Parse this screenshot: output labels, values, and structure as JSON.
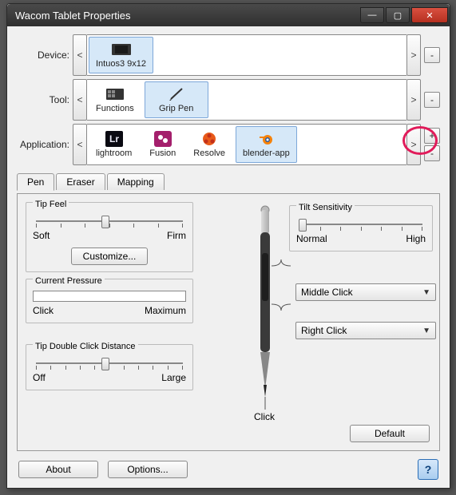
{
  "window": {
    "title": "Wacom Tablet Properties"
  },
  "selectors": {
    "device": {
      "label": "Device:",
      "items": [
        {
          "label": "Intuos3 9x12",
          "selected": true,
          "icon": "tablet"
        }
      ]
    },
    "tool": {
      "label": "Tool:",
      "items": [
        {
          "label": "Functions",
          "selected": false,
          "icon": "functions"
        },
        {
          "label": "Grip Pen",
          "selected": true,
          "icon": "pen"
        }
      ]
    },
    "application": {
      "label": "Application:",
      "items": [
        {
          "label": "lightroom",
          "selected": false,
          "icon": "lr"
        },
        {
          "label": "Fusion",
          "selected": false,
          "icon": "fusion"
        },
        {
          "label": "Resolve",
          "selected": false,
          "icon": "resolve"
        },
        {
          "label": "blender-app",
          "selected": true,
          "icon": "blender"
        }
      ]
    }
  },
  "tabs": {
    "items": [
      "Pen",
      "Eraser",
      "Mapping"
    ],
    "active": 0
  },
  "tipFeel": {
    "title": "Tip Feel",
    "min": "Soft",
    "max": "Firm",
    "pos": 0.45,
    "customize": "Customize..."
  },
  "currentPressure": {
    "title": "Current Pressure",
    "min": "Click",
    "max": "Maximum"
  },
  "tipDoubleClick": {
    "title": "Tip Double Click Distance",
    "min": "Off",
    "max": "Large",
    "pos": 0.45
  },
  "tilt": {
    "title": "Tilt Sensitivity",
    "min": "Normal",
    "max": "High",
    "pos": 0.05
  },
  "penButtons": {
    "upper": "Middle Click",
    "lower": "Right Click",
    "tip": "Click"
  },
  "default_btn": "Default",
  "bottom": {
    "about": "About",
    "options": "Options..."
  },
  "scroll": {
    "left": "<",
    "right": ">",
    "plus": "+",
    "minus": "-"
  }
}
